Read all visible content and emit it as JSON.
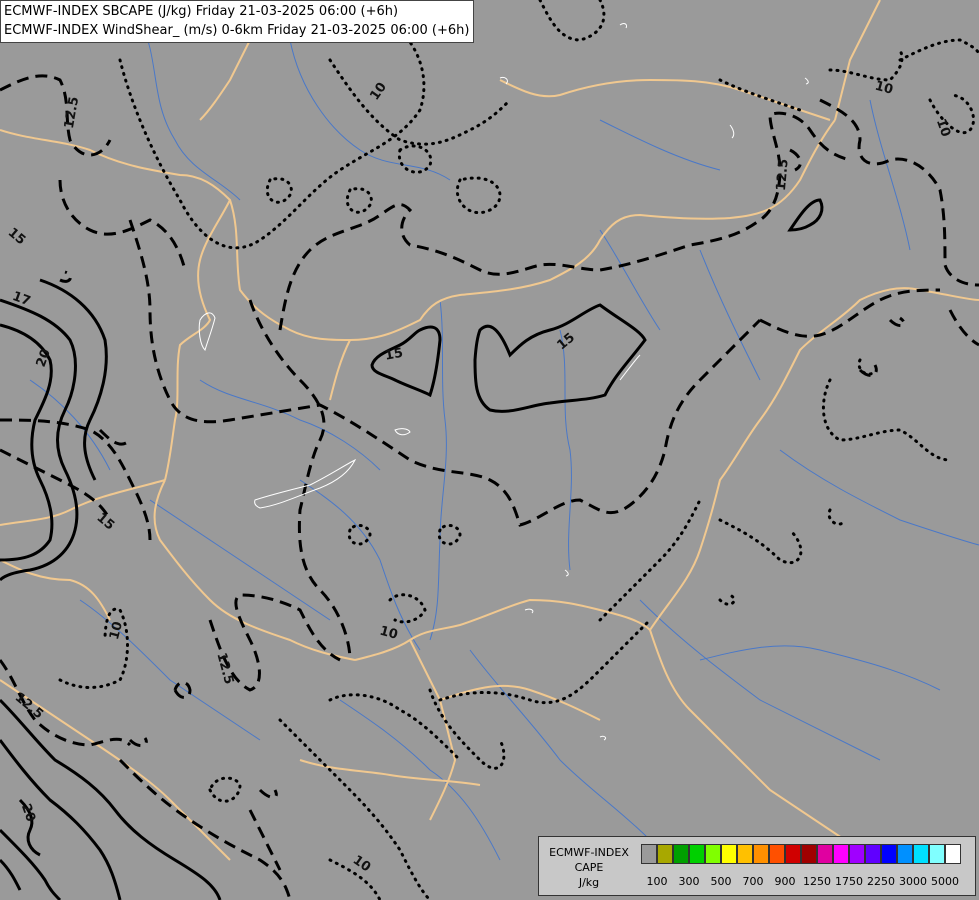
{
  "titles": {
    "line1": "ECMWF-INDEX SBCAPE (J/kg) Friday 21-03-2025 06:00 (+6h)",
    "line2": "ECMWF-INDEX WindShear_ (m/s) 0-6km Friday 21-03-2025 06:00 (+6h)"
  },
  "contour_labels": [
    "10",
    "12.5",
    "15",
    "17",
    "20"
  ],
  "legend": {
    "line1": "ECMWF-INDEX",
    "line2": "CAPE",
    "line3": "J/kg",
    "colors": [
      "#9a9a9a",
      "#a8a800",
      "#00a000",
      "#00d000",
      "#80ff00",
      "#ffff00",
      "#ffc000",
      "#ff9000",
      "#ff5000",
      "#d00000",
      "#a00000",
      "#e000a0",
      "#ff00ff",
      "#a000ff",
      "#6000ff",
      "#0000ff",
      "#0090ff",
      "#00e0ff",
      "#80ffff",
      "#ffffff"
    ],
    "ticks": [
      "100",
      "300",
      "500",
      "700",
      "900",
      "1250",
      "1750",
      "2250",
      "3000",
      "5000"
    ]
  },
  "colors": {
    "background": "#9a9a9a",
    "borders": "#f0c890",
    "rivers": "#4a78c8",
    "contours": "#000000"
  }
}
